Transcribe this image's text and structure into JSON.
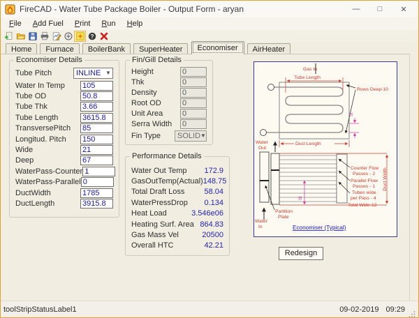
{
  "window": {
    "title": "FireCAD - Water Tube Package Boiler - Output Form - aryan",
    "controls": [
      {
        "name": "minimize-icon",
        "glyph": "—"
      },
      {
        "name": "maximize-icon",
        "glyph": "□"
      },
      {
        "name": "close-icon",
        "glyph": "✕"
      }
    ]
  },
  "menu": {
    "items": [
      "File",
      "Add Fuel",
      "Print",
      "Run",
      "Help"
    ]
  },
  "toolbar": {
    "icons": [
      "new-file-icon",
      "open-folder-icon",
      "save-icon",
      "print-icon",
      "design-icon",
      "add-circle-icon",
      "output-form-icon",
      "help-icon",
      "exit-icon"
    ]
  },
  "tabs": {
    "items": [
      "Home",
      "Furnace",
      "BoilerBank",
      "SuperHeater",
      "Economiser",
      "AirHeater"
    ],
    "selected": "Economiser"
  },
  "economiser": {
    "legend": "Economiser Details",
    "tube_pitch_label": "Tube Pitch",
    "tube_pitch_value": "INLINE",
    "rows": [
      {
        "label": "Water In Temp",
        "value": "105"
      },
      {
        "label": "Tube OD",
        "value": "50.8"
      },
      {
        "label": "Tube Thk",
        "value": "3.66"
      },
      {
        "label": "Tube Length",
        "value": "3615.8"
      },
      {
        "label": "TransversePitch",
        "value": "85"
      },
      {
        "label": "Longitud. Pitch",
        "value": "150"
      },
      {
        "label": "Wide",
        "value": "21"
      },
      {
        "label": "Deep",
        "value": "67"
      },
      {
        "label": "WaterPass-Counter",
        "value": "1"
      },
      {
        "label": "WaterPass-Parallel",
        "value": "0"
      },
      {
        "label": "DuctWidth",
        "value": "1785"
      },
      {
        "label": "DuctLength",
        "value": "3915.8"
      }
    ]
  },
  "fin": {
    "legend": "Fin/Gill Details",
    "rows": [
      {
        "label": "Height",
        "value": "0"
      },
      {
        "label": "Thk",
        "value": "0"
      },
      {
        "label": "Density",
        "value": "0"
      },
      {
        "label": "Root OD",
        "value": "0"
      },
      {
        "label": "Unit Area",
        "value": "0"
      },
      {
        "label": "Serra Width",
        "value": "0"
      }
    ],
    "fin_type_label": "Fin Type",
    "fin_type_value": "SOLID"
  },
  "performance": {
    "legend": "Performance Details",
    "rows": [
      {
        "label": "Water Out Temp",
        "value": "172.9"
      },
      {
        "label": "GasOutTemp(Actual)",
        "value": "148.75"
      },
      {
        "label": "Total Draft Loss",
        "value": "58.04"
      },
      {
        "label": "WaterPressDrop",
        "value": "0.134"
      },
      {
        "label": "Heat Load",
        "value": "3.546e06"
      },
      {
        "label": "Heating Surf. Area",
        "value": "864.83"
      },
      {
        "label": "Gas Mass Vel",
        "value": "20500"
      },
      {
        "label": "Overall HTC",
        "value": "42.21"
      }
    ]
  },
  "diagram": {
    "gas_in": "Gas In",
    "tube_length": "Tube Length",
    "rows_deep": "Rows Deep-10",
    "duct_length": "Duct Length",
    "water_out_1": "Water",
    "water_out_2": "Out",
    "pitch_label_top": "Sl",
    "counter_flow_1": "Counter Flow",
    "counter_flow_2": "Passes - 2",
    "parallel_flow_1": "Parallel Flow",
    "parallel_flow_2": "Passes - 1",
    "tubes_wide_1": "Tubes wide",
    "tubes_wide_2": "per Pass - 4",
    "total_wide": "Total Wide-12",
    "duct_width": "Duct Width",
    "partition_1": "Partition",
    "partition_2": "Plate",
    "water_in_1": "Water",
    "water_in_2": "In",
    "pitch_label_mid": "St",
    "caption": "Economiser (Typical)"
  },
  "actions": {
    "redesign": "Redesign"
  },
  "statusbar": {
    "label": "toolStripStatusLabel1",
    "date": "09-02-2019",
    "time": "09:29"
  },
  "colors": {
    "window_border": "#dfa23b",
    "content_bg": "#f1ede0",
    "value_blue": "#1a1aa6",
    "diagram_red": "#d23a2e",
    "diagram_magenta": "#d8399b",
    "link_blue": "#1515cc",
    "panel_border": "#3a3aa0"
  }
}
